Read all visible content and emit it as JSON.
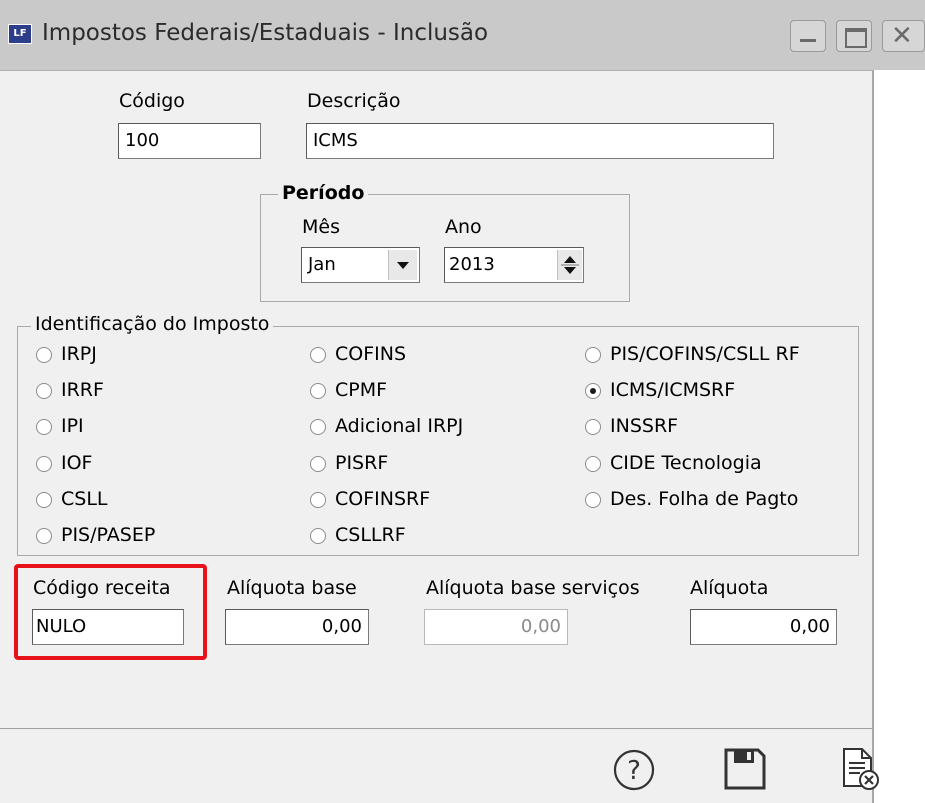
{
  "window": {
    "app_icon_text": "LF",
    "title": "Impostos Federais/Estaduais - Inclusão"
  },
  "fields": {
    "codigo_label": "Código",
    "codigo_value": "100",
    "descricao_label": "Descrição",
    "descricao_value": "ICMS"
  },
  "periodo": {
    "legend": "Período",
    "mes_label": "Mês",
    "mes_value": "Jan",
    "ano_label": "Ano",
    "ano_value": "2013"
  },
  "identificacao": {
    "legend": "Identificação do Imposto",
    "selected": "ICMS/ICMSRF",
    "col1": [
      "IRPJ",
      "IRRF",
      "IPI",
      "IOF",
      "CSLL",
      "PIS/PASEP"
    ],
    "col2": [
      "COFINS",
      "CPMF",
      "Adicional IRPJ",
      "PISRF",
      "COFINSRF",
      "CSLLRF"
    ],
    "col3": [
      "PIS/COFINS/CSLL RF",
      "ICMS/ICMSRF",
      "INSSRF",
      "CIDE Tecnologia",
      "Des. Folha de Pagto"
    ]
  },
  "bottom_fields": {
    "codigo_receita_label": "Código receita",
    "codigo_receita_value": "NULO",
    "aliquota_base_label": "Alíquota base",
    "aliquota_base_value": "0,00",
    "aliquota_base_servicos_label": "Alíquota base serviços",
    "aliquota_base_servicos_value": "0,00",
    "aliquota_label": "Alíquota",
    "aliquota_value": "0,00"
  },
  "highlight_color": "#e8131a",
  "toolbar_icons": [
    "help-icon",
    "save-icon",
    "cancel-document-icon"
  ]
}
